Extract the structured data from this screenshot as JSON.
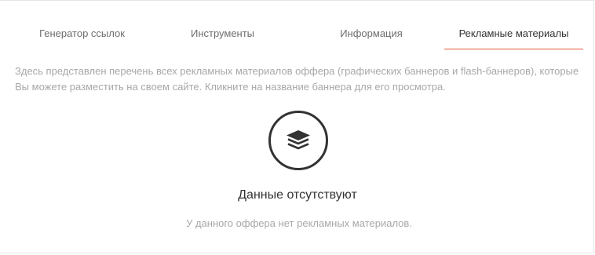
{
  "tabs": [
    {
      "label": "Генератор ссылок",
      "active": false
    },
    {
      "label": "Инструменты",
      "active": false
    },
    {
      "label": "Информация",
      "active": false
    },
    {
      "label": "Рекламные материалы",
      "active": true
    }
  ],
  "description": "Здесь представлен перечень всех рекламных материалов оффера (графических баннеров и flash-баннеров), которые Вы можете разместить на своем сайте. Кликните на название баннера для его просмотра.",
  "empty_state": {
    "icon": "layers-icon",
    "title": "Данные отсутствуют",
    "subtitle": "У данного оффера нет рекламных материалов."
  },
  "colors": {
    "accent": "#e25a3a",
    "text_dark": "#333333",
    "text_muted": "#a8a8a8",
    "tab_text": "#6e6e6e"
  }
}
